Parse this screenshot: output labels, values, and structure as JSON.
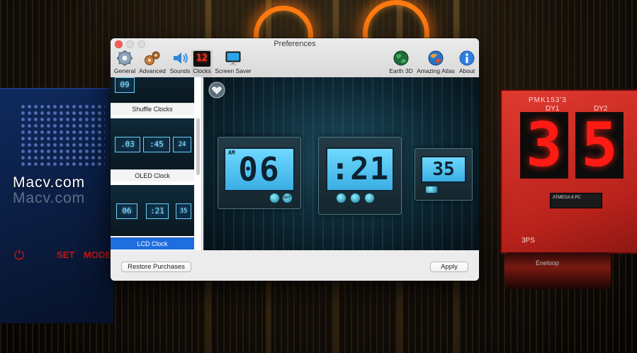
{
  "desktop": {
    "watermark": "Macv.com",
    "watermark_shadow": "Macv.com",
    "left_board": {
      "set_label": "SET",
      "mode_label": "MODE"
    },
    "right_board": {
      "chip_label": "PMK153'3",
      "dy1_label": "DY1",
      "dy2_label": "DY2",
      "digit_1": "3",
      "digit_2": "5",
      "chip_text": "ATMEGA 8 PC",
      "bottom_label": "3PS",
      "battery_label": "Eneloop"
    }
  },
  "window": {
    "title": "Preferences",
    "toolbar": {
      "items": [
        {
          "label": "General",
          "icon": "gear-icon"
        },
        {
          "label": "Advanced",
          "icon": "gears-advanced-icon"
        },
        {
          "label": "Sounds",
          "icon": "speaker-icon"
        },
        {
          "label": "Clocks",
          "icon": "clock-digits-icon",
          "selected": true,
          "icon_text": "12"
        },
        {
          "label": "Screen Saver",
          "icon": "monitor-icon"
        },
        {
          "label": "Earth 3D",
          "icon": "globe-icon"
        },
        {
          "label": "Amazing Atlas",
          "icon": "atlas-globe-icon"
        },
        {
          "label": "About",
          "icon": "info-icon"
        }
      ]
    },
    "sidebar": {
      "items": [
        {
          "label": "Shuffle Clocks",
          "thumb": [
            "09"
          ]
        },
        {
          "label": "OLED Clock",
          "thumb": [
            ".03",
            ":45",
            "24"
          ]
        },
        {
          "label": "LCD Clock",
          "thumb": [
            "06",
            ":21",
            "35"
          ],
          "selected": true
        }
      ]
    },
    "preview": {
      "am_label": "AM",
      "hours": "06",
      "minutes": ":21",
      "seconds": "35",
      "knob_set": "SET"
    },
    "footer": {
      "restore_label": "Restore Purchases",
      "apply_label": "Apply"
    }
  },
  "colors": {
    "accent_selection": "#1e6ee0",
    "lcd_screen": "#5cc8f5",
    "close_button": "#fc5f57",
    "segment_red": "#ff1a14"
  }
}
